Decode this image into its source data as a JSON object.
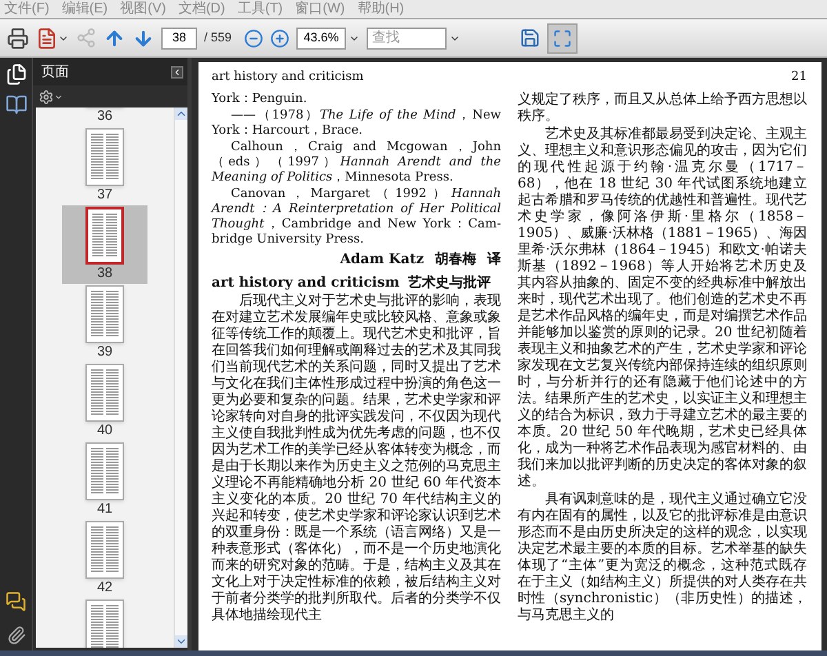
{
  "menu": [
    {
      "label": "文件(F)"
    },
    {
      "label": "编辑(E)"
    },
    {
      "label": "视图(V)"
    },
    {
      "label": "文档(D)"
    },
    {
      "label": "工具(T)"
    },
    {
      "label": "窗口(W)"
    },
    {
      "label": "帮助(H)"
    }
  ],
  "toolbar": {
    "share_disabled": true,
    "page_field": "38",
    "page_total": "/ 559",
    "zoom_field": "43.6%",
    "search": {
      "placeholder": "查找"
    },
    "full_screen_pressed": true
  },
  "sidebar": {
    "title": "页面",
    "thumbnails": [
      {
        "label": "36",
        "selected": false
      },
      {
        "label": "37",
        "selected": false
      },
      {
        "label": "38",
        "selected": true
      },
      {
        "label": "39",
        "selected": false
      },
      {
        "label": "40",
        "selected": false
      },
      {
        "label": "41",
        "selected": false
      },
      {
        "label": "42",
        "selected": false
      },
      {
        "selected": false
      }
    ]
  },
  "document": {
    "running_head": "art history and criticism",
    "page_number": "21",
    "columns": [
      {
        "blocks": [
          {
            "kind": "ref-continued",
            "text": "York：Penguin."
          },
          {
            "kind": "ref",
            "text": "——（1978）*The Life of the Mind*，New York：Harcourt，Brace."
          },
          {
            "kind": "ref",
            "text": "Calhoun，Craig and Mcgowan，John（eds）（1997）*Hannah Arendt and the Meaning of Politics*，Minnesota Press."
          },
          {
            "kind": "ref",
            "text": "Canovan，Margaret（1992）*Hannah Arendt：A Reinterpretation of Her Political Thought*，Cambridge and New York：Cam-bridge University Press."
          },
          {
            "kind": "signature",
            "author": "Adam Katz",
            "translator": "胡春梅",
            "note": "译"
          },
          {
            "kind": "heading",
            "en": "art history and criticism",
            "zh": "艺术史与批评"
          },
          {
            "kind": "para",
            "text": "后现代主义对于艺术史与批评的影响，表现在对建立艺术发展编年史或比较风格、意象或象征等传统工作的颠覆上。现代艺术史和批评，旨在回答我们如何理解或阐释过去的艺术及其同我们当前现代艺术的关系问题，同时又提出了艺术与文化在我们主体性形成过程中扮演的角色这一更为必要和复杂的问题。结果，艺术史学家和评论家转向对自身的批评实践发问，不仅因为现代主义使自我批判性成为优先考虑的问题，也不仅因为艺术工作的美学已经从客体转变为概念，而是由于长期以来作为历史主义之范例的马克思主义理论不再能精确地分析 20 世纪 60 年代资本主义变化的本质。20 世纪 70 年代结构主义的兴起和转变，使艺术史学家和评论家认识到艺术的双重身份：既是一个系统（语言网络）又是一种表意形式（客体化），而不是一个历史地演化而来的研究对象的范畴。于是，结构主义及其在文化上对于决定性标准的依赖，被后结构主义对于前者分类学的批判所取代。后者的分类学不仅具体地描绘现代主"
          }
        ]
      },
      {
        "blocks": [
          {
            "kind": "para-continued",
            "text": "义规定了秩序，而且又从总体上给予西方思想以秩序。"
          },
          {
            "kind": "para",
            "text": "艺术史及其标准都最易受到决定论、主观主义、理想主义和意识形态偏见的攻击，因为它们的现代性起源于约翰·温克尔曼（1717－68），他在 18 世纪 30 年代试图系统地建立起古希腊和罗马传统的优越性和普遍性。现代艺术史学家，像阿洛伊斯·里格尔（1858－1905）、威廉·沃林格（1881－1965）、海因里希·沃尔弗林（1864－1945）和欧文·帕诺夫斯基（1892－1968）等人开始将艺术历史及其内容从抽象的、固定不变的经典标准中解放出来时，现代艺术出现了。他们创造的艺术史不再是艺术作品风格的编年史，而是对编撰艺术作品并能够加以鉴赏的原则的记录。20 世纪初随着表现主义和抽象艺术的产生，艺术史学家和评论家发现在文艺复兴传统内部保持连续的组织原则时，与分析并行的还有隐藏于他们论述中的方法。结果所产生的艺术史，以实证主义和理想主义的结合为标识，致力于寻建立艺术的最主要的本质。20 世纪 50 年代晚期，艺术史已经具体化，成为一种将艺术作品表现为感官材料的、由我们来加以批评判断的历史决定的客体对象的叙述。"
          },
          {
            "kind": "para",
            "text": "具有讽刺意味的是，现代主义通过确立它没有内在固有的属性，以及它的批评标准是由意识形态而不是由历史所决定的这样的观念，以实现决定艺术最主要的本质的目标。艺术举基的缺失体现了“主体”更为宽泛的概念，这种范式既存在于主义（如结构主义）所提供的对人类存在共时性（synchronistic）（非历史性）的描述，与马克思主义的"
          }
        ]
      }
    ]
  }
}
